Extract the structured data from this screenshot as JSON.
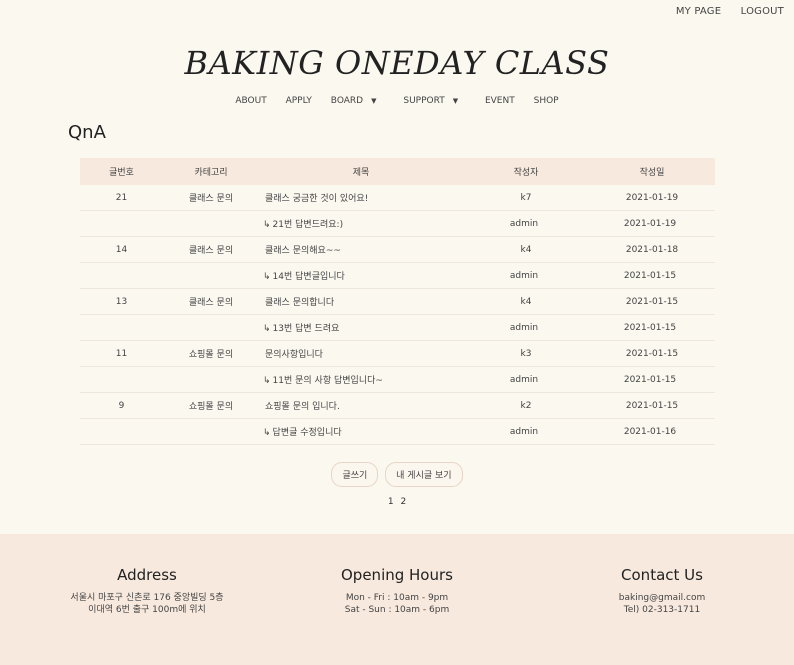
{
  "topbar": {
    "mypage": "MY PAGE",
    "logout": "LOGOUT"
  },
  "logo": "BAKING ONEDAY CLASS",
  "nav": {
    "about": "ABOUT",
    "apply": "APPLY",
    "board": "BOARD",
    "support": "SUPPORT",
    "event": "EVENT",
    "shop": "SHOP"
  },
  "page_title": "QnA",
  "table": {
    "headers": {
      "no": "글번호",
      "category": "카테고리",
      "title": "제목",
      "author": "작성자",
      "date": "작성일"
    },
    "rows": [
      {
        "no": "21",
        "category": "클래스 문의",
        "title": "클래스 궁금한 것이 있어요!",
        "author": "k7",
        "date": "2021-01-19",
        "reply": false
      },
      {
        "no": "",
        "category": "",
        "title": "21번 답변드려요:)",
        "author": "admin",
        "date": "2021-01-19",
        "reply": true
      },
      {
        "no": "14",
        "category": "클래스 문의",
        "title": "클래스 문의해요~~",
        "author": "k4",
        "date": "2021-01-18",
        "reply": false
      },
      {
        "no": "",
        "category": "",
        "title": "14번 답변글입니다",
        "author": "admin",
        "date": "2021-01-15",
        "reply": true
      },
      {
        "no": "13",
        "category": "클래스 문의",
        "title": "클래스 문의합니다",
        "author": "k4",
        "date": "2021-01-15",
        "reply": false
      },
      {
        "no": "",
        "category": "",
        "title": "13번 답변 드려요",
        "author": "admin",
        "date": "2021-01-15",
        "reply": true
      },
      {
        "no": "11",
        "category": "쇼핑몰 문의",
        "title": "문의사항입니다",
        "author": "k3",
        "date": "2021-01-15",
        "reply": false
      },
      {
        "no": "",
        "category": "",
        "title": "11번 문의 사항 답변입니다~",
        "author": "admin",
        "date": "2021-01-15",
        "reply": true
      },
      {
        "no": "9",
        "category": "쇼핑몰 문의",
        "title": "쇼핑몰 문의 입니다.",
        "author": "k2",
        "date": "2021-01-15",
        "reply": false
      },
      {
        "no": "",
        "category": "",
        "title": "답변글 수정입니다",
        "author": "admin",
        "date": "2021-01-16",
        "reply": true
      }
    ]
  },
  "buttons": {
    "write": "글쓰기",
    "my_posts": "내 게시글 보기"
  },
  "pagination": [
    "1",
    "2"
  ],
  "footer": {
    "address": {
      "title": "Address",
      "line1": "서울시 마포구 신촌로 176 중앙빌딩 5층",
      "line2": "이대역 6번 출구 100m에 위치"
    },
    "hours": {
      "title": "Opening Hours",
      "line1": "Mon - Fri : 10am - 9pm",
      "line2": "Sat - Sun : 10am - 6pm"
    },
    "contact": {
      "title": "Contact Us",
      "line1": "baking@gmail.com",
      "line2": "Tel) 02-313-1711"
    }
  },
  "icons": {
    "reply": "reply-arrow-icon",
    "caret": "caret-down-icon"
  },
  "colors": {
    "background": "#fbf8f0",
    "accent": "#f7e9de"
  }
}
